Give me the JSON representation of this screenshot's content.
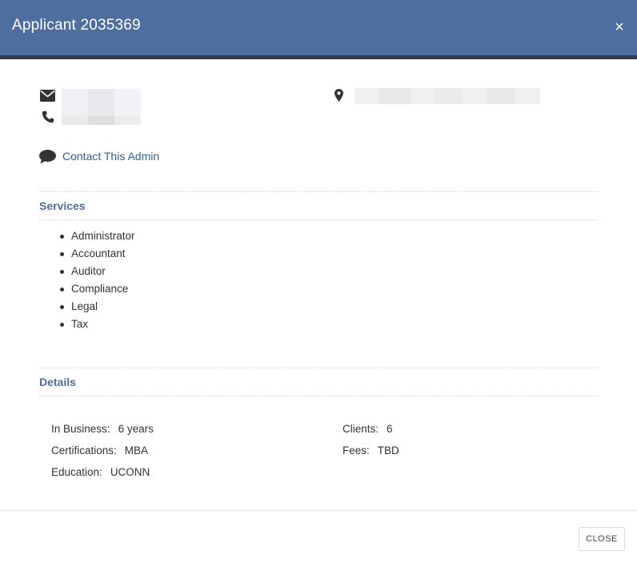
{
  "modal": {
    "title": "Applicant 2035369",
    "close_glyph": "×"
  },
  "contact": {
    "email_icon": "envelope-icon",
    "phone_icon": "phone-icon",
    "location_icon": "map-marker-icon",
    "chat_icon": "comment-icon",
    "contact_link": "Contact This Admin"
  },
  "services": {
    "title": "Services",
    "items": [
      "Administrator",
      "Accountant",
      "Auditor",
      "Compliance",
      "Legal",
      "Tax"
    ]
  },
  "details": {
    "title": "Details",
    "in_business_label": "In Business:",
    "in_business_value": "6 years",
    "certifications_label": "Certifications:",
    "certifications_value": "MBA",
    "education_label": "Education:",
    "education_value": "UCONN",
    "clients_label": "Clients:",
    "clients_value": "6",
    "fees_label": "Fees:",
    "fees_value": "TBD"
  },
  "footer": {
    "close_label": "CLOSE"
  },
  "colors": {
    "header": "#4d6e9f",
    "header_border": "#2f3b4e",
    "accent": "#4d6e9f",
    "link": "#2f5f95"
  }
}
